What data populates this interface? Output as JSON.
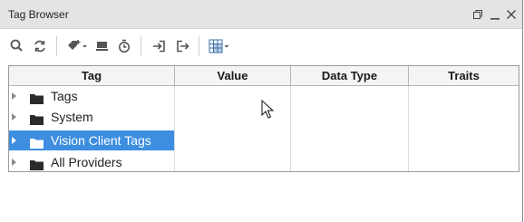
{
  "window": {
    "title": "Tag Browser"
  },
  "toolbar": {
    "icons": [
      "search-icon",
      "refresh-icon",
      "add-tag-icon",
      "export-icon",
      "history-icon",
      "import-icon",
      "logout-icon",
      "grid-view-icon"
    ]
  },
  "table": {
    "columns": [
      "Tag",
      "Value",
      "Data Type",
      "Traits"
    ],
    "rows": [
      {
        "label": "Tags",
        "selected": false
      },
      {
        "label": "System",
        "selected": false
      },
      {
        "label": "Vision Client Tags",
        "selected": true
      },
      {
        "label": "All Providers",
        "selected": false
      }
    ]
  },
  "colors": {
    "selection": "#3d8ee0",
    "titlebar": "#e4e4e4"
  }
}
